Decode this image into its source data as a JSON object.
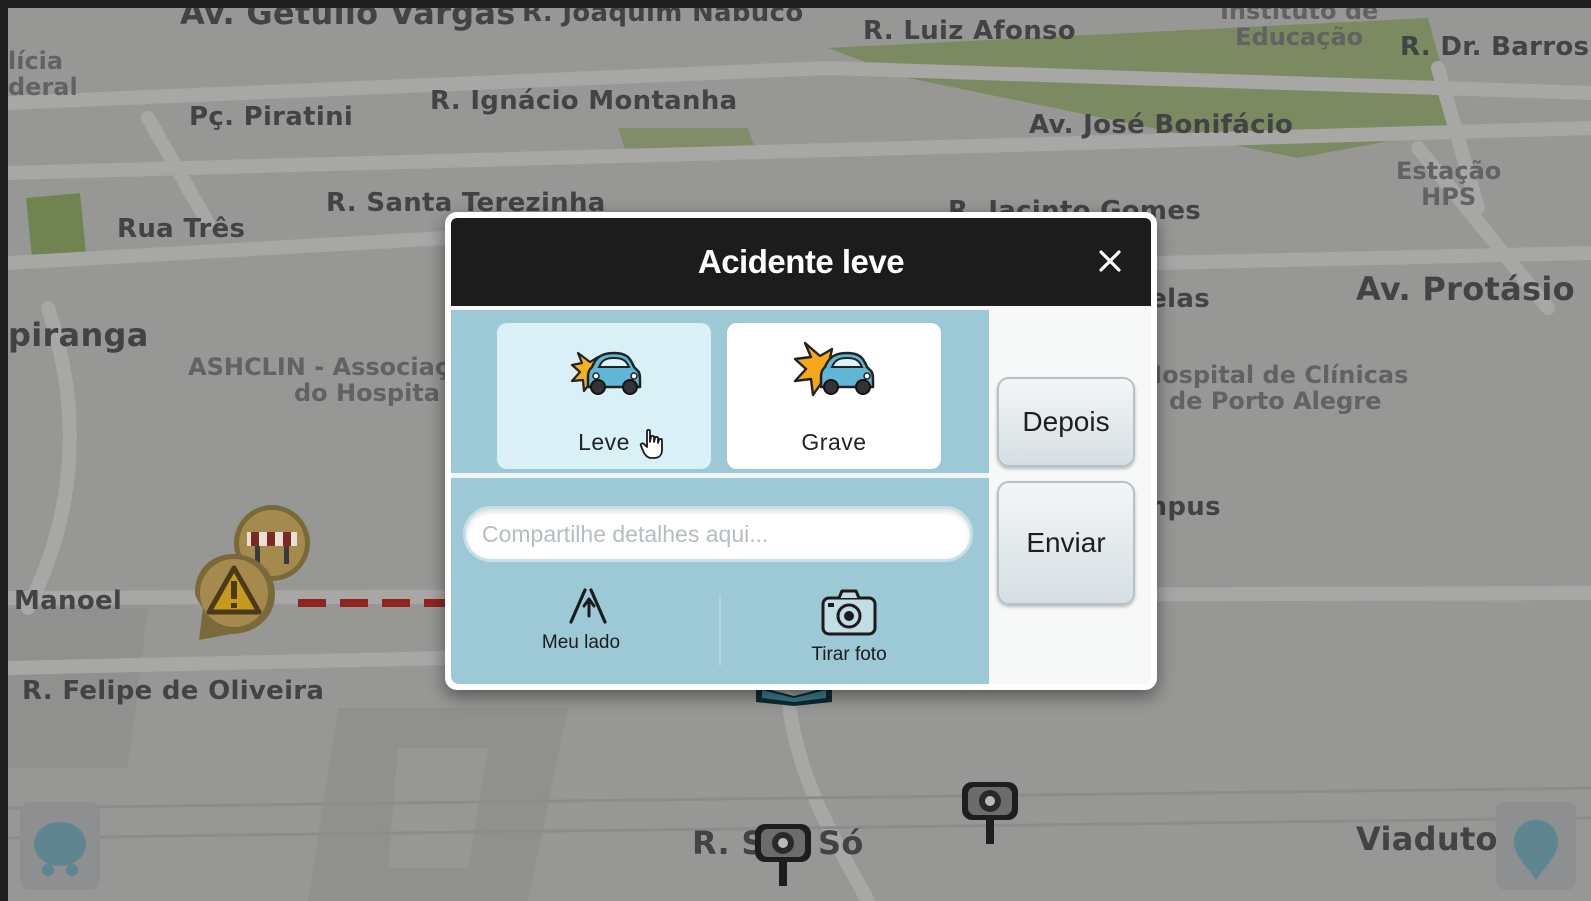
{
  "map": {
    "streets": [
      "Av. Getúlio Vargas",
      "R. Joaquim Nabuco",
      "R. Luiz Afonso",
      "R. Dr. Barros",
      "Pç. Piratini",
      "R. Ignácio Montanha",
      "Av. José Bonifácio",
      "Rua Três",
      "R. Santa Terezinha",
      "R. Jacinto Gomes",
      "Av. Protásio",
      "piranga",
      "Manoel",
      "R. Felipe de Oliveira",
      "R. S",
      "Só",
      "Viaduto",
      "ielas",
      "mpus"
    ],
    "pois": {
      "instituto": [
        "Instituto de",
        "Educação"
      ],
      "estacao": [
        "Estação",
        "HPS"
      ],
      "justica": [
        "lícia",
        "deral"
      ],
      "ashclin": [
        "ASHCLIN - Associaç",
        "do Hospita"
      ],
      "hospital": [
        "Hospital de Clínicas",
        "de Porto Alegre"
      ]
    },
    "icons": {
      "hazard": "warning-triangle-icon",
      "roadwork": "road-barrier-icon",
      "camera": "speed-camera-icon",
      "menu": "waze-menu-icon",
      "report": "report-pin-icon"
    }
  },
  "dialog": {
    "title": "Acidente leve",
    "close_symbol": "✕",
    "options": [
      {
        "label": "Leve",
        "selected": true,
        "icon": "minor-accident-icon"
      },
      {
        "label": "Grave",
        "selected": false,
        "icon": "major-accident-icon"
      }
    ],
    "details_placeholder": "Compartilhe detalhes aqui...",
    "tools": {
      "my_side_label": "Meu lado",
      "photo_label": "Tirar foto"
    },
    "buttons": {
      "later_label": "Depois",
      "send_label": "Enviar"
    }
  },
  "colors": {
    "header_bg": "#1c1c1c",
    "panel_bg": "#9dc8d5",
    "selected_card_bg": "#d9f1f6",
    "map_bg": "#d9dad6"
  }
}
